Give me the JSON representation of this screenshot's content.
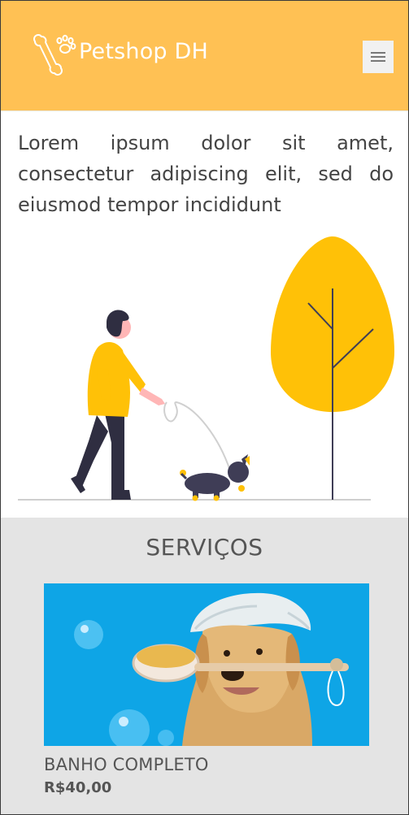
{
  "header": {
    "brand": "Petshop DH",
    "menu_icon": "hamburger-menu-icon",
    "logo_icon": "bone-paw-icon",
    "background_color": "#ffc154"
  },
  "intro": {
    "text": "Lorem ipsum dolor sit amet, consectetur adipiscing elit, sed do eiusmod tempor incididunt"
  },
  "illustration": {
    "icon": "person-walking-dog-illustration",
    "accent_color": "#ffc107"
  },
  "services": {
    "title": "SERVIÇOS",
    "items": [
      {
        "name": "BANHO COMPLETO",
        "price": "R$40,00",
        "image": "dog-bath-photo"
      }
    ]
  }
}
